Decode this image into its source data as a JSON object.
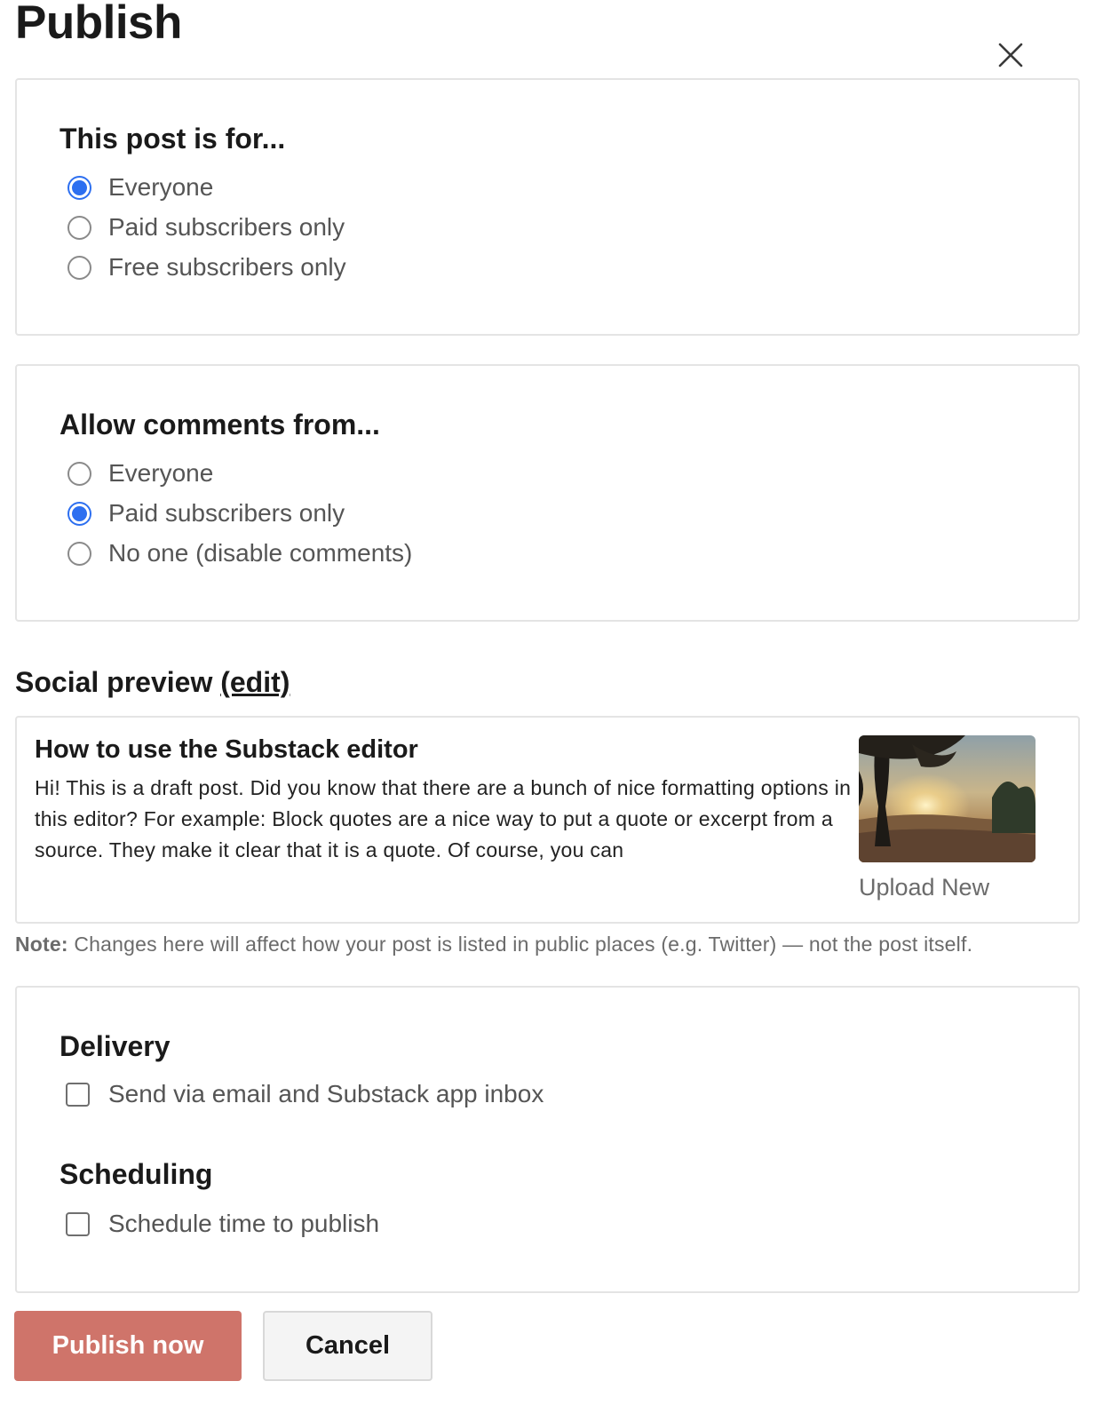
{
  "dialog": {
    "title": "Publish",
    "close_icon": "close-icon"
  },
  "audience": {
    "heading": "This post is for...",
    "options": [
      {
        "label": "Everyone",
        "selected": true
      },
      {
        "label": "Paid subscribers only",
        "selected": false
      },
      {
        "label": "Free subscribers only",
        "selected": false
      }
    ]
  },
  "comments": {
    "heading": "Allow comments from...",
    "options": [
      {
        "label": "Everyone",
        "selected": false
      },
      {
        "label": "Paid subscribers only",
        "selected": true
      },
      {
        "label": "No one (disable comments)",
        "selected": false
      }
    ]
  },
  "social_preview": {
    "heading": "Social preview",
    "edit_label": "(edit)",
    "post_title": "How to use the Substack editor",
    "post_description": "Hi! This is a draft post. Did you know that there are a bunch of nice formatting options in this editor? For example: Block quotes are a nice way to put a quote or excerpt from a source. They make it clear that it is a quote. Of course, you can",
    "upload_label": "Upload New",
    "thumbnail": "tree-sunset-photo"
  },
  "note": {
    "label": "Note:",
    "text": " Changes here will affect how your post is listed in public places (e.g. Twitter) — not the post itself."
  },
  "delivery": {
    "heading": "Delivery",
    "option_label": "Send via email and Substack app inbox",
    "checked": false
  },
  "scheduling": {
    "heading": "Scheduling",
    "option_label": "Schedule time to publish",
    "checked": false
  },
  "actions": {
    "publish_label": "Publish now",
    "cancel_label": "Cancel"
  },
  "colors": {
    "accent_radio": "#2d6ff0",
    "publish_button": "#cf746a"
  }
}
